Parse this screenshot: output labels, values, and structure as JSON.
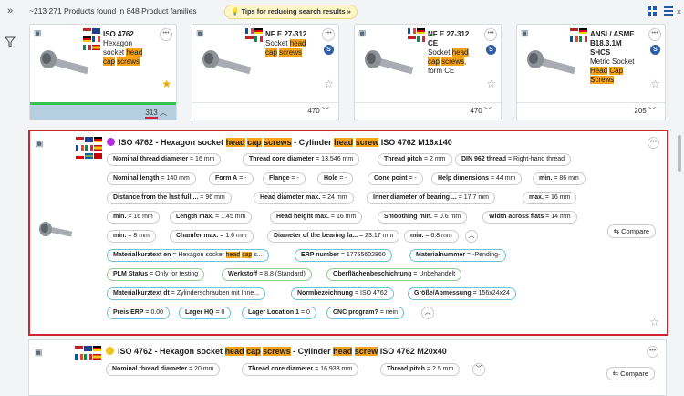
{
  "header": {
    "result_count": "~213 271 Products found in 848 Product families",
    "tips_label": "Tips for reducing search results",
    "tips_chevron": "»"
  },
  "cards": [
    {
      "t1": "ISO 4762",
      "t2": "Hexagon",
      "t3": "socket",
      "t3h": "head",
      "t4h": "cap",
      "t5h": "screws",
      "count": "313",
      "chevron": "^"
    },
    {
      "t1": "NF E 27-312",
      "t2a": "Socket",
      "t2h": "head",
      "t3h": "cap",
      "t3h2": "screws",
      "count": "470",
      "chevron": "v"
    },
    {
      "t1": "NF E 27-312",
      "t1b": "CE",
      "t2": "Socket",
      "t2h": "head",
      "t3h": "cap",
      "t3h2": "screws",
      "t3c": ",",
      "t4": "form CE",
      "count": "470",
      "chevron": "v"
    },
    {
      "t1": "ANSI / ASME",
      "t1b": "B18.3.1M",
      "t1c": "SHCS",
      "t2": "Metric Socket",
      "t3h": "Head",
      "t3h2": "Cap",
      "t4h": "Screws",
      "count": "205",
      "chevron": "v"
    }
  ],
  "row1": {
    "title_a": "ISO 4762 - Hexagon socket ",
    "h1": "head",
    "h2": "cap",
    "h3": "screws",
    "title_b": " - Cylinder ",
    "h4": "head",
    "h5": "screw",
    "title_c": " ISO 4762 M16x140",
    "dot_color": "#b42ee0",
    "pills": [
      [
        "Nominal thread diameter",
        " = 16 mm"
      ],
      [
        "Thread core diameter",
        " = 13.546 mm"
      ],
      [
        "Thread pitch",
        " = 2 mm"
      ],
      [
        "DIN 962 thread",
        " = Right-hand thread"
      ],
      [
        "Nominal length",
        " = 140 mm"
      ],
      [
        "Form A",
        " = -"
      ],
      [
        "Flange",
        " = -"
      ],
      [
        "Hole",
        " = -"
      ],
      [
        "Cone point",
        " = -"
      ],
      [
        "Help dimensions",
        " = 44 mm"
      ],
      [
        "min.",
        " = 86 mm"
      ],
      [
        "Distance from the last full ...",
        " = 96 mm"
      ],
      [
        "Head diameter max.",
        " = 24 mm"
      ],
      [
        "Inner diameter of bearing ...",
        " = 17.7 mm"
      ],
      [
        "max.",
        " = 16 mm"
      ],
      [
        "min.",
        " = 16 mm"
      ],
      [
        "Length max.",
        " = 1.45 mm"
      ],
      [
        "Head height max.",
        " = 16 mm"
      ],
      [
        "Smoothing min.",
        " = 0.6 mm"
      ],
      [
        "Width across flats",
        " = 14 mm"
      ],
      [
        "min.",
        " = 8 mm"
      ],
      [
        "Chamfer max.",
        " = 1.6 mm"
      ],
      [
        "Diameter of the bearing fa...",
        " = 23.17 mm"
      ],
      [
        "min.",
        " = 6.8 mm"
      ],
      [
        "Materialkurztext en",
        " = Hexagon socket "
      ],
      [
        "ERP number",
        " = 17755602860"
      ],
      [
        "Materialnummer",
        " = -Pending-"
      ],
      [
        "PLM Status",
        " = Only for testing"
      ],
      [
        "Werkstoff",
        " = 8.8 (Standard)"
      ],
      [
        "Oberflächenbeschichtung",
        " = Unbehandelt"
      ],
      [
        "Materialkurztext dt",
        " = Zylinderschrauben mit Inne..."
      ],
      [
        "Normbezeichnung",
        " = ISO 4762"
      ],
      [
        "Größe/Abmessung",
        " = 156x24x24"
      ],
      [
        "Preis ERP",
        " = 0.00"
      ],
      [
        "Lager HQ",
        " = 0"
      ],
      [
        "Lager Location 1",
        " = 0"
      ],
      [
        "CNC program?",
        " = nein"
      ]
    ],
    "mat_h1": "head",
    "mat_h2": "cap",
    "mat_tail": " s...",
    "compare": "Compare"
  },
  "row2": {
    "title_a": "ISO 4762 - Hexagon socket ",
    "h1": "head",
    "h2": "cap",
    "h3": "screws",
    "title_b": " - Cylinder ",
    "h4": "head",
    "h5": "screw",
    "title_c": " ISO 4762 M20x40",
    "dot_color": "#f0c419",
    "pills": [
      [
        "Nominal thread diameter",
        " = 20 mm"
      ],
      [
        "Thread core diameter",
        " = 16.933 mm"
      ],
      [
        "Thread pitch",
        " = 2.5 mm"
      ]
    ],
    "compare": "Compare"
  },
  "icons": [
    "expand-icon",
    "filter-icon",
    "cube-icon",
    "more-icon",
    "star-icon",
    "compare-icon",
    "grid-view-icon",
    "list-view-icon",
    "collapse-icon"
  ]
}
